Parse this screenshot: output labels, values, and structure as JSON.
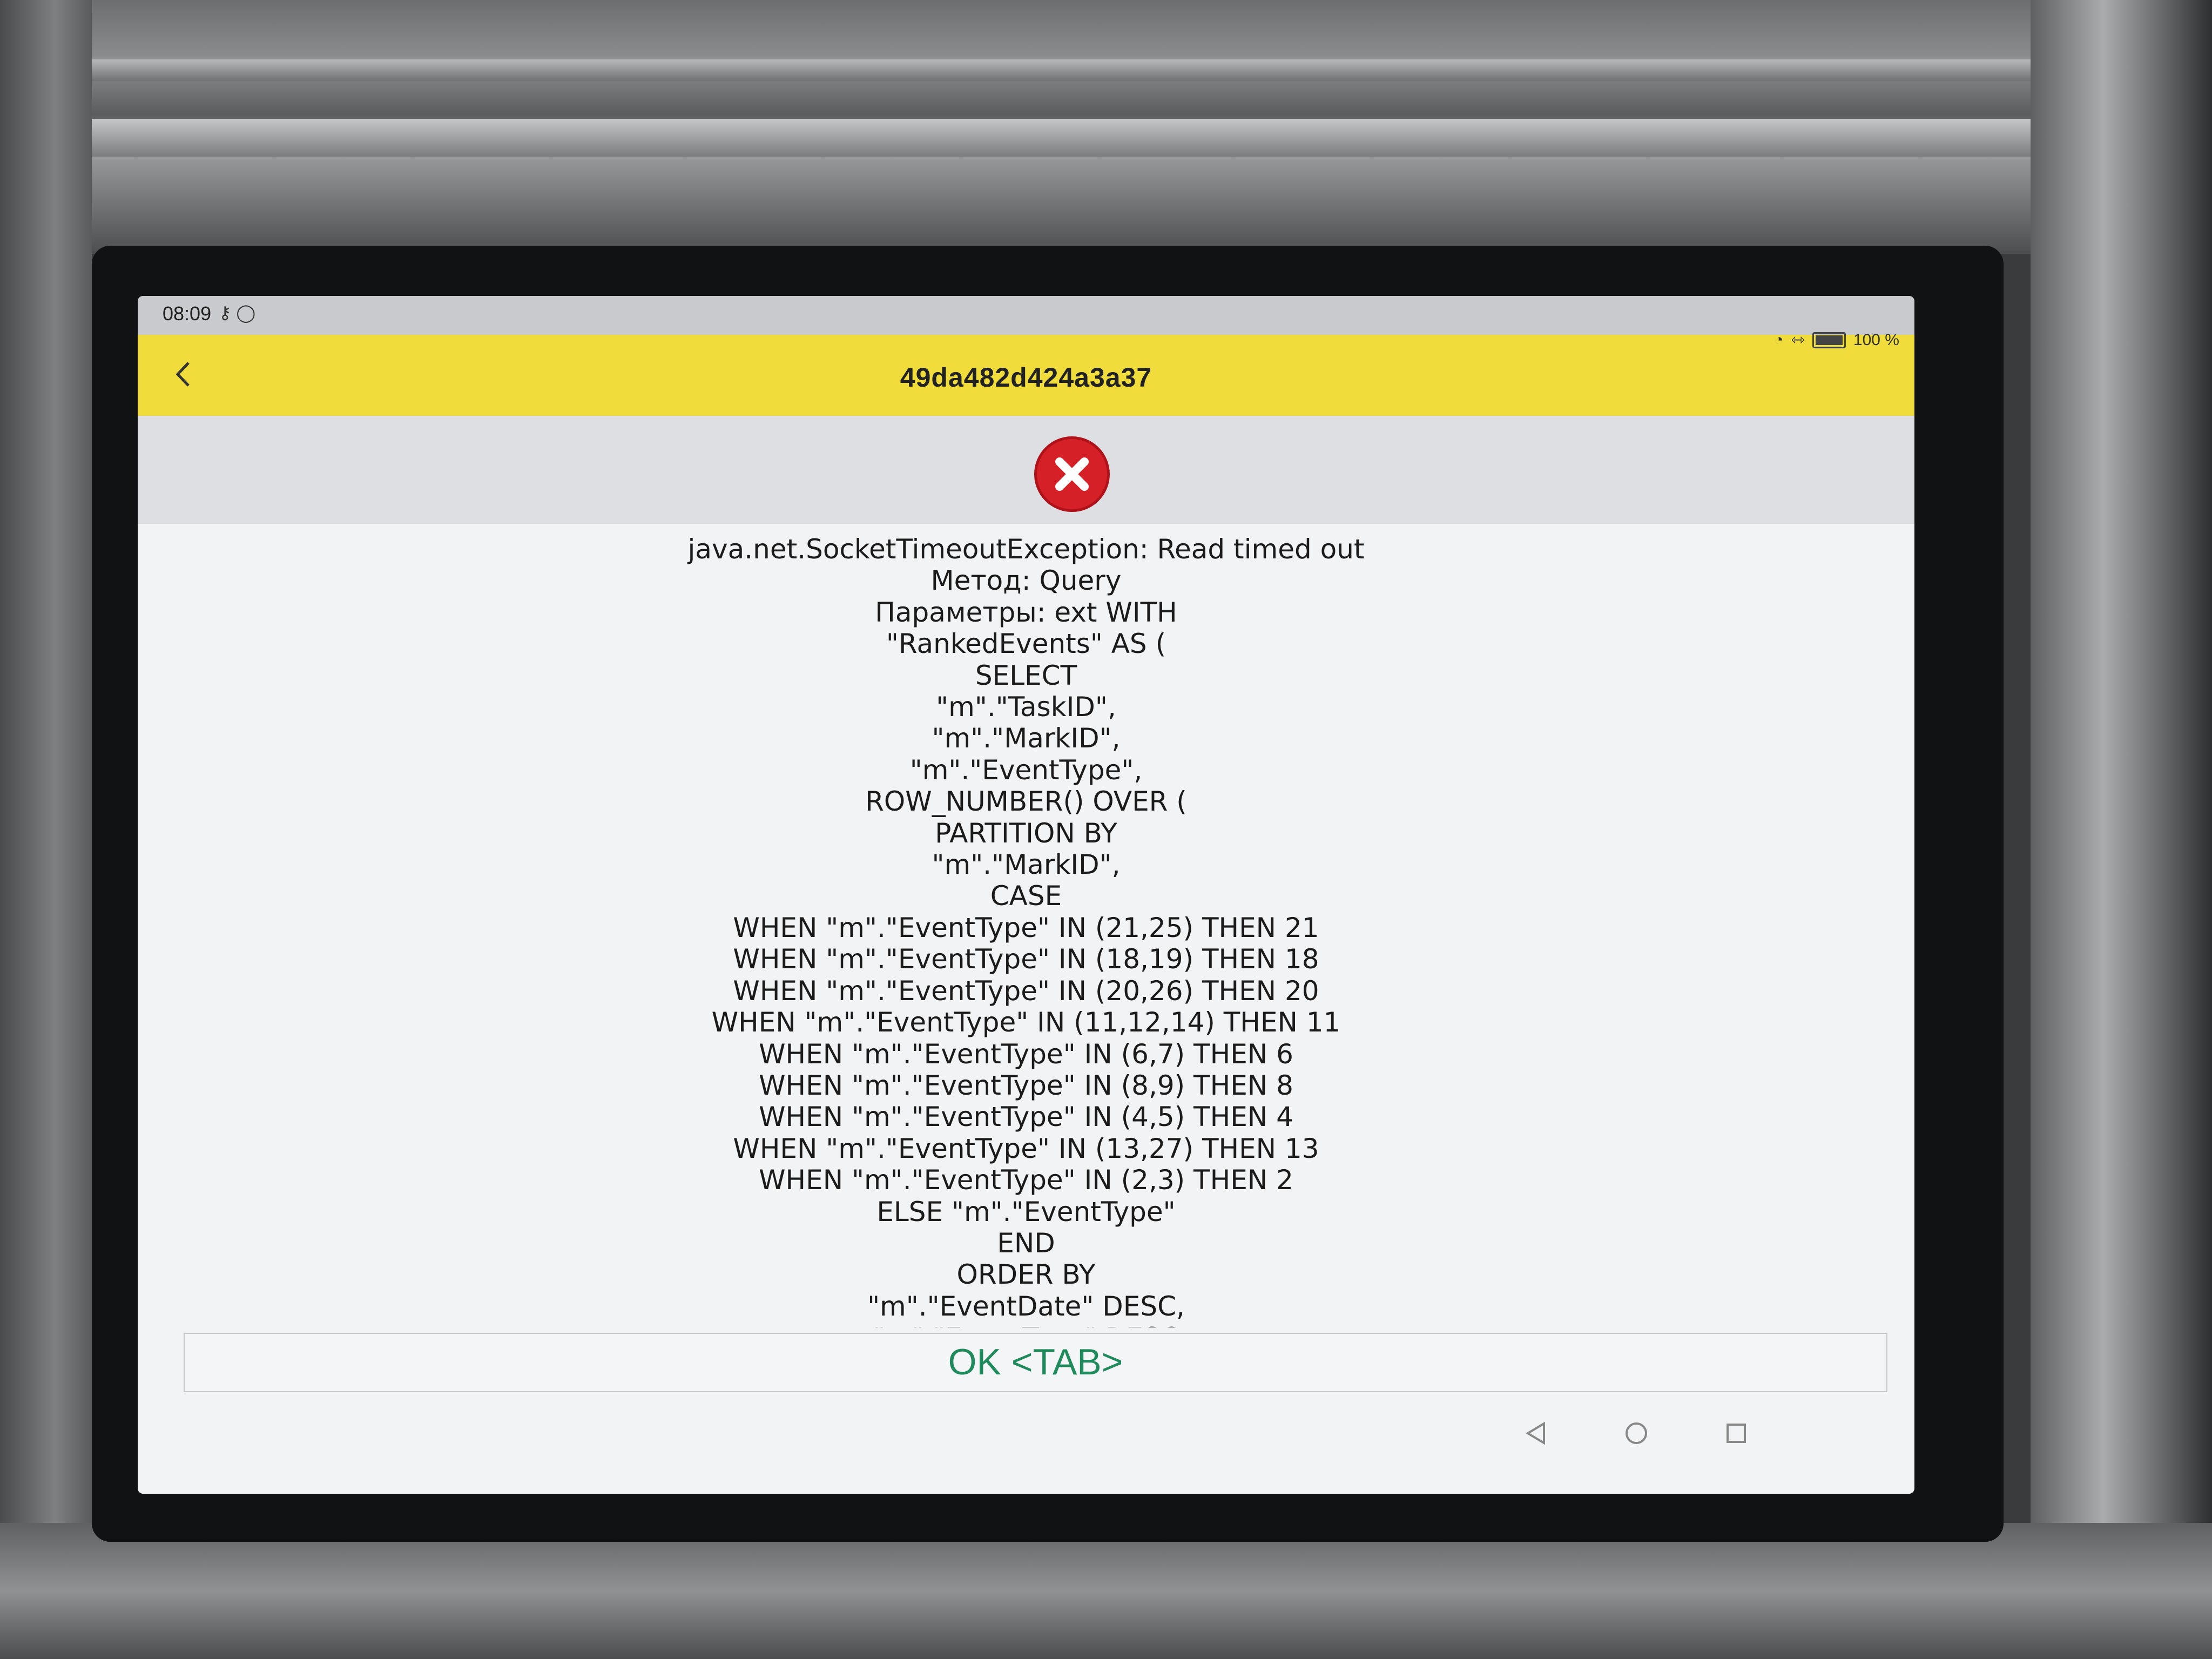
{
  "status_bar": {
    "time": "08:09",
    "battery": "100 %",
    "icons": [
      "key-icon",
      "sync-icon",
      "speed-icon",
      "network-icon",
      "battery-icon"
    ]
  },
  "header": {
    "title": "49da482d424a3a37",
    "back_icon": "chevron-left-icon",
    "color": "#f0dd3c"
  },
  "error": {
    "icon": "error-x-icon",
    "color": "#d52027",
    "lines": [
      "java.net.SocketTimeoutException: Read timed out",
      "Метод: Query",
      "Параметры: ext WITH",
      "\"RankedEvents\" AS (",
      "SELECT",
      "\"m\".\"TaskID\",",
      "\"m\".\"MarkID\",",
      "\"m\".\"EventType\",",
      "ROW_NUMBER() OVER (",
      "PARTITION BY",
      "\"m\".\"MarkID\",",
      "CASE",
      "WHEN \"m\".\"EventType\" IN (21,25) THEN 21",
      "WHEN \"m\".\"EventType\" IN (18,19) THEN 18",
      "WHEN \"m\".\"EventType\" IN (20,26) THEN 20",
      "WHEN \"m\".\"EventType\" IN (11,12,14) THEN 11",
      "WHEN \"m\".\"EventType\" IN (6,7) THEN 6",
      "WHEN \"m\".\"EventType\" IN (8,9) THEN 8",
      "WHEN \"m\".\"EventType\" IN (4,5) THEN 4",
      "WHEN \"m\".\"EventType\" IN (13,27) THEN 13",
      "WHEN \"m\".\"EventType\" IN (2,3) THEN 2",
      "ELSE \"m\".\"EventType\"",
      "END",
      "ORDER BY",
      "\"m\".\"EventDate\" DESC,",
      "\"m\".\"EventType\" DESC"
    ]
  },
  "ok_button": {
    "label": "OK <TAB>",
    "color": "#1f8a5b"
  },
  "nav_bar": {
    "icons": [
      "back-triangle-icon",
      "home-circle-icon",
      "recent-square-icon"
    ]
  }
}
